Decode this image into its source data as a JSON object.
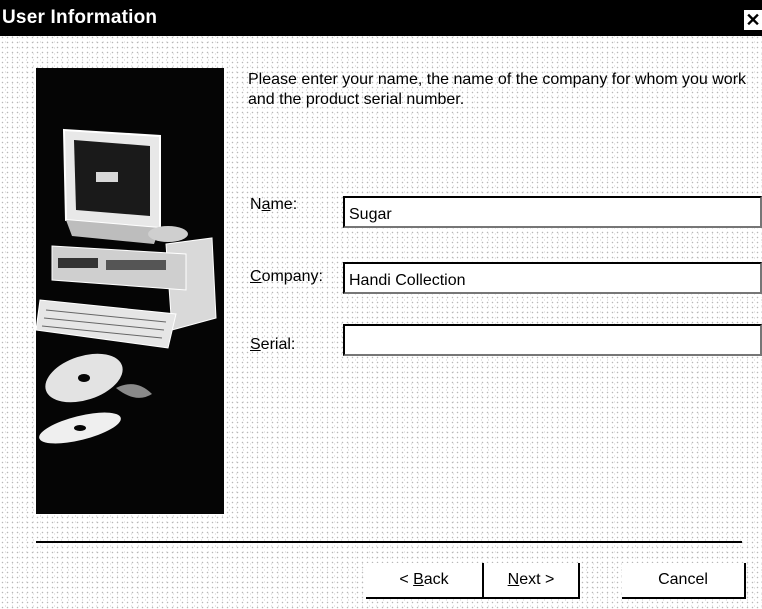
{
  "window": {
    "title": "User Information",
    "close_glyph": "✕"
  },
  "instructions": "Please enter your name, the name of the company for whom you work and the product serial number.",
  "form": {
    "name": {
      "label_prefix": "N",
      "label_accel": "a",
      "label_suffix": "me:",
      "value": "Sugar"
    },
    "company": {
      "label_prefix": "",
      "label_accel": "C",
      "label_suffix": "ompany:",
      "value": "Handi Collection"
    },
    "serial": {
      "label_prefix": "",
      "label_accel": "S",
      "label_suffix": "erial:",
      "value": ""
    }
  },
  "buttons": {
    "back": {
      "prefix": "< ",
      "accel": "B",
      "suffix": "ack"
    },
    "next": {
      "prefix": "",
      "accel": "N",
      "suffix": "ext >"
    },
    "cancel": "Cancel"
  },
  "colors": {
    "titlebar": "#000000",
    "panel": "#050505"
  }
}
